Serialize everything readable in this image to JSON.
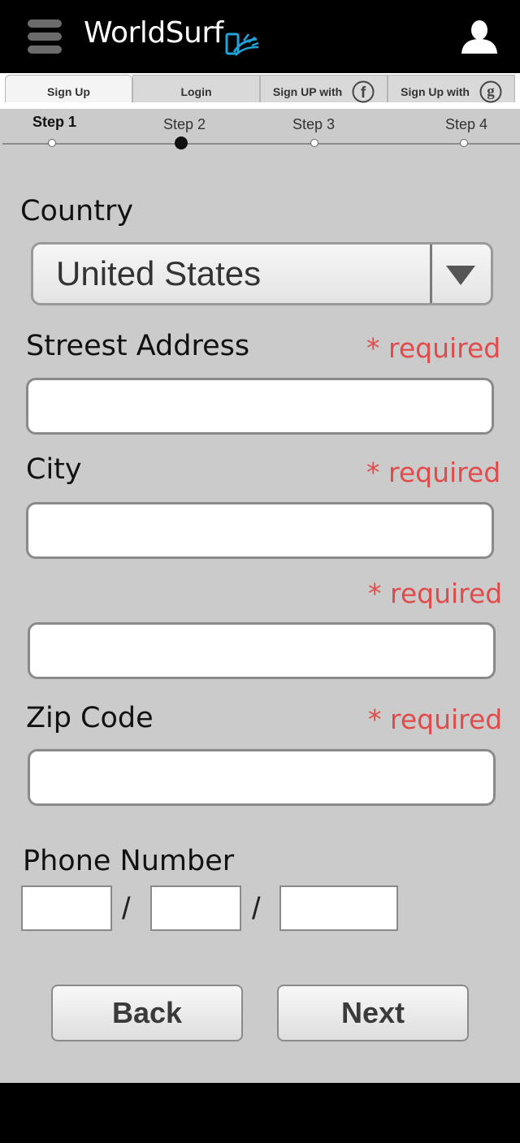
{
  "app": {
    "title": "WorldSurf"
  },
  "header": {
    "menu_icon": "hamburger-menu-icon",
    "logo_icon": "surf-splash-icon",
    "profile_icon": "user-silhouette-icon"
  },
  "tabs": [
    {
      "label": "Sign Up",
      "active": true
    },
    {
      "label": "Login",
      "active": false
    },
    {
      "label": "Sign UP with",
      "icon": "facebook-icon",
      "glyph": "f"
    },
    {
      "label": "Sign Up with",
      "icon": "google-icon",
      "glyph": "g"
    }
  ],
  "steps": [
    {
      "label": "Step 1",
      "state": "done"
    },
    {
      "label": "Step 2",
      "state": "current"
    },
    {
      "label": "Step 3",
      "state": "pending"
    },
    {
      "label": "Step 4",
      "state": "pending"
    }
  ],
  "form": {
    "country": {
      "label": "Country",
      "value": "United States"
    },
    "street": {
      "label": "Streest Address",
      "required": "* required",
      "value": ""
    },
    "city": {
      "label": "City",
      "required": "* required",
      "value": ""
    },
    "state": {
      "label": "",
      "required": "* required",
      "value": ""
    },
    "zip": {
      "label": "Zip Code",
      "required": "* required",
      "value": ""
    },
    "phone": {
      "label": "Phone Number",
      "separator": "/"
    }
  },
  "buttons": {
    "back": "Back",
    "next": "Next"
  },
  "colors": {
    "required": "#e24b4b",
    "background": "#cbcbcb",
    "header": "#000000",
    "logo_accent": "#1fa3d9"
  }
}
